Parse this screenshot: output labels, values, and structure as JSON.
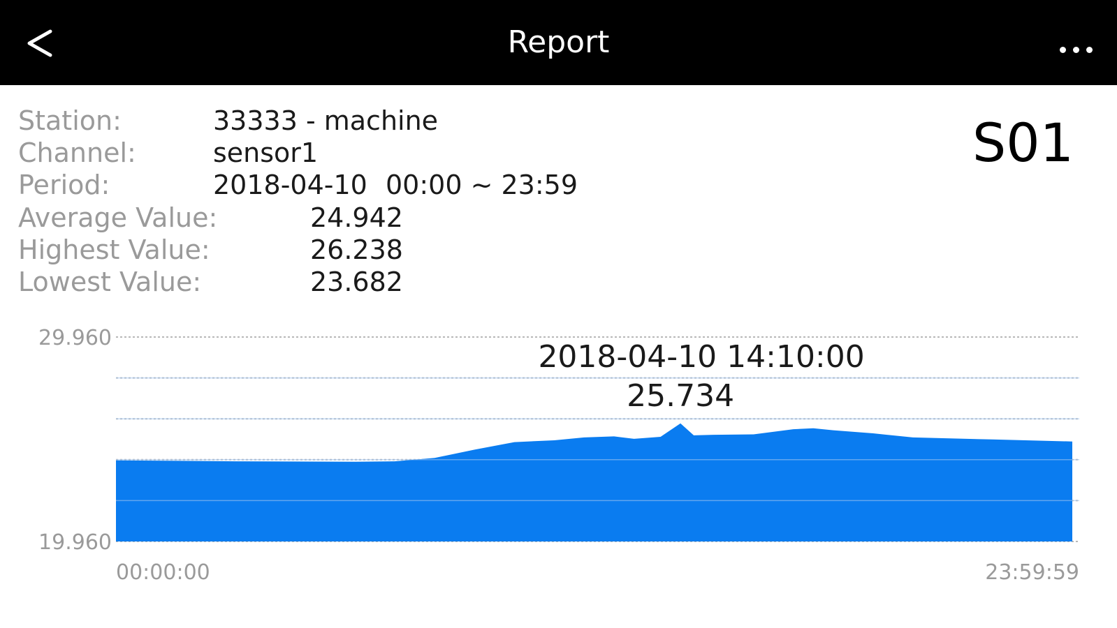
{
  "header": {
    "title": "Report",
    "back_label": "<",
    "more_icon": "more-horizontal-icon"
  },
  "info": {
    "station_label": "Station:",
    "station_value": "33333 - machine",
    "channel_label": "Channel:",
    "channel_value": "sensor1",
    "period_label": "Period:",
    "period_date": "2018-04-10",
    "period_range": "00:00 ~ 23:59",
    "average_label": "Average Value:",
    "average_value": "24.942",
    "highest_label": "Highest Value:",
    "highest_value": "26.238",
    "lowest_label": "Lowest Value:",
    "lowest_value": "23.682",
    "code": "S01"
  },
  "chart_data": {
    "type": "area",
    "title": "",
    "xlabel": "",
    "ylabel": "",
    "x_tick_labels": [
      "00:00:00",
      "23:59:59"
    ],
    "y_tick_labels": [
      "29.960",
      "19.960"
    ],
    "ylim": [
      19.96,
      29.96
    ],
    "xlim": [
      "00:00:00",
      "23:59:59"
    ],
    "grid": true,
    "fill_color": "#0a7cf0",
    "grid_color": "#b8b8b8",
    "highlight": {
      "x": "14:10:00",
      "label_date": "2018-04-10 14:10:00",
      "label_value": "25.734",
      "value": 25.734
    },
    "series": [
      {
        "x": [
          "00:00:00",
          "03:00:00",
          "06:00:00",
          "07:00:00",
          "08:00:00",
          "09:00:00",
          "10:00:00",
          "11:00:00",
          "11:45:00",
          "12:30:00",
          "13:00:00",
          "13:40:00",
          "14:10:00",
          "14:30:00",
          "15:00:00",
          "16:00:00",
          "17:00:00",
          "17:30:00",
          "18:00:00",
          "19:00:00",
          "20:00:00",
          "22:00:00",
          "23:59:59"
        ],
        "values": [
          23.93,
          23.88,
          23.86,
          23.88,
          24.05,
          24.45,
          24.82,
          24.91,
          25.05,
          25.1,
          24.98,
          25.08,
          25.734,
          25.15,
          25.18,
          25.2,
          25.45,
          25.5,
          25.4,
          25.25,
          25.05,
          24.95,
          24.85
        ]
      }
    ]
  }
}
